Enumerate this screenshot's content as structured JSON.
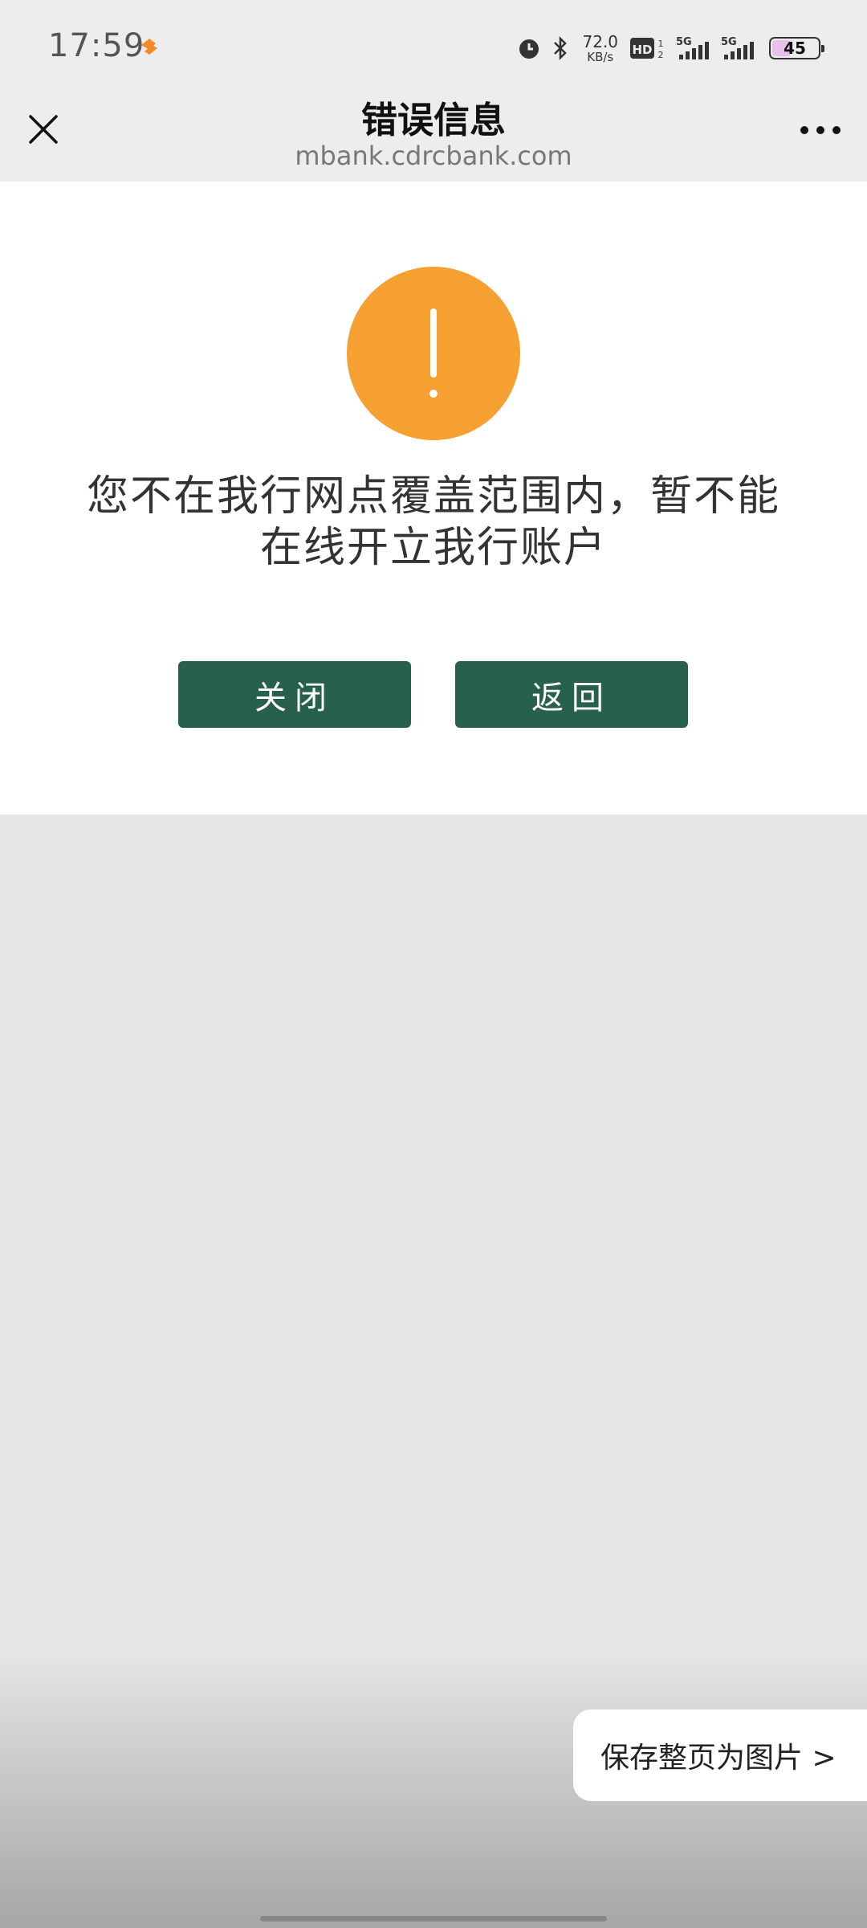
{
  "status_bar": {
    "time": "17:59",
    "net_speed_value": "72.0",
    "net_speed_unit": "KB/s",
    "battery_level": "45",
    "battery_color": "#e7c1ea",
    "icons": [
      "alarm-icon",
      "bluetooth-icon",
      "hd-icon",
      "signal-5g-icon",
      "signal-5g-icon"
    ]
  },
  "titlebar": {
    "title": "错误信息",
    "subtitle": "mbank.cdrcbank.com"
  },
  "content": {
    "icon": "warning-icon",
    "icon_color": "#f7a032",
    "message_line1": "您不在我行网点覆盖范围内，暂不能",
    "message_line2": "在线开立我行账户",
    "close_button": "关闭",
    "back_button": "返回",
    "button_color": "#27604b"
  },
  "save_pill": {
    "label": "保存整页为图片 >"
  }
}
